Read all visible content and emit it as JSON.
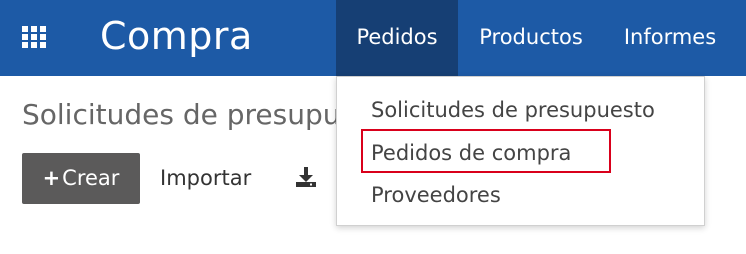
{
  "navbar": {
    "apps_icon": "grid-apps-icon",
    "title": "Compra",
    "menu": [
      {
        "label": "Pedidos",
        "active": true
      },
      {
        "label": "Productos",
        "active": false
      },
      {
        "label": "Informes",
        "active": false
      }
    ]
  },
  "dropdown": {
    "items": [
      {
        "label": "Solicitudes de presupuesto"
      },
      {
        "label": "Pedidos de compra",
        "highlighted": true
      },
      {
        "label": "Proveedores"
      }
    ]
  },
  "main": {
    "breadcrumb": "Solicitudes de presupuesto",
    "create_button": {
      "icon": "plus-icon",
      "label": "Crear"
    },
    "import_button": "Importar",
    "download_icon": "download-icon"
  },
  "colors": {
    "navbar_bg": "#1d5aa6",
    "navbar_active_bg": "#163f74",
    "create_button_bg": "#5b5a5a",
    "highlight_border": "#d9001b"
  }
}
